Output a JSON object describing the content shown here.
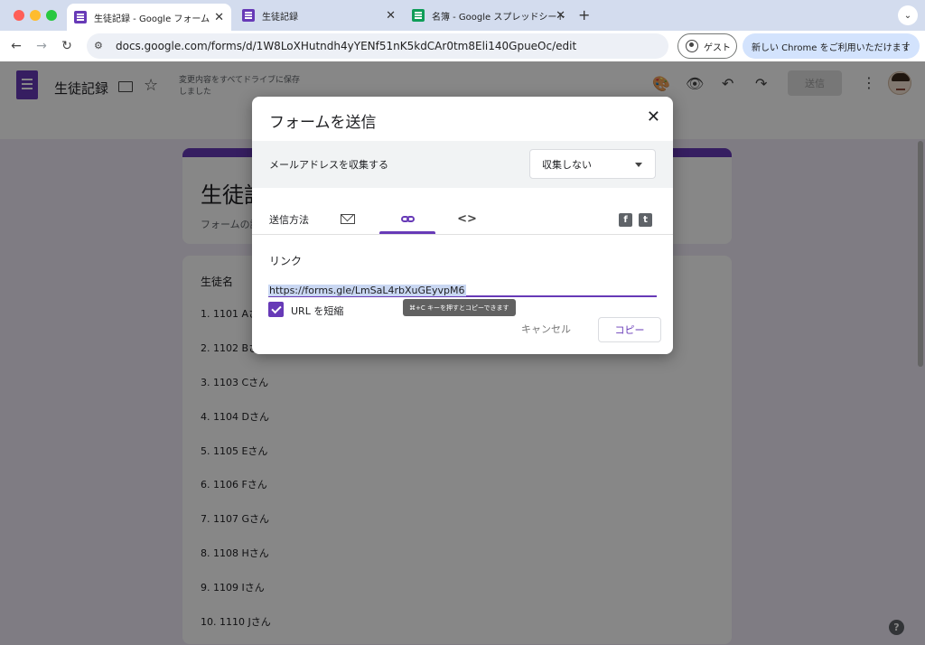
{
  "browser": {
    "tabs": [
      {
        "title": "生徒記録 - Google フォーム",
        "active": true
      },
      {
        "title": "生徒記録",
        "active": false
      },
      {
        "title": "名簿 - Google スプレッドシート",
        "active": false
      }
    ],
    "close_glyph": "✕",
    "new_tab_glyph": "+",
    "tab_menu_glyph": "⌄",
    "url": "docs.google.com/forms/d/1W8LoXHutndh4yYENf51nK5kdCAr0tm8Eli140GpueOc/edit",
    "guest_label": "ゲスト",
    "promo_text": "新しい Chrome をご利用いただけます",
    "promo_menu_glyph": "⋮",
    "nav": {
      "back": "←",
      "forward": "→",
      "reload": "↻"
    }
  },
  "app": {
    "doc_title": "生徒記録",
    "save_status": "変更内容をすべてドライブに保存しました",
    "send_label": "送信",
    "icons": {
      "palette": "🎨",
      "preview": "👁",
      "undo": "↶",
      "redo": "↷",
      "more": "⋮",
      "star": "☆"
    }
  },
  "form": {
    "title": "生徒記録",
    "description": "フォームの説明",
    "question_title": "生徒名",
    "options": [
      "1.  1101 Aさん",
      "2.  1102 Bさん",
      "3.  1103 Cさん",
      "4.  1104 Dさん",
      "5.  1105 Eさん",
      "6.  1106 Fさん",
      "7.  1107 Gさん",
      "8.  1108 Hさん",
      "9.  1109 Iさん",
      "10.  1110 Jさん"
    ],
    "help_glyph": "?"
  },
  "dialog": {
    "title": "フォームを送信",
    "close_glyph": "✕",
    "collect_email_label": "メールアドレスを収集する",
    "collect_email_value": "収集しない",
    "send_via_label": "送信方法",
    "active_method": "link",
    "code_glyph": "<>",
    "facebook_glyph": "f",
    "twitter_glyph": "t",
    "link_section_label": "リンク",
    "link_url": "https://forms.gle/LmSaL4rbXuGEyvpM6",
    "tooltip": "⌘+C キーを押すとコピーできます",
    "shorten_url_label": "URL を短縮",
    "shorten_url_checked": true,
    "cancel_label": "キャンセル",
    "copy_label": "コピー"
  },
  "colors": {
    "accent": "#673ab7",
    "overlay": "rgba(0,0,0,0.47)"
  }
}
